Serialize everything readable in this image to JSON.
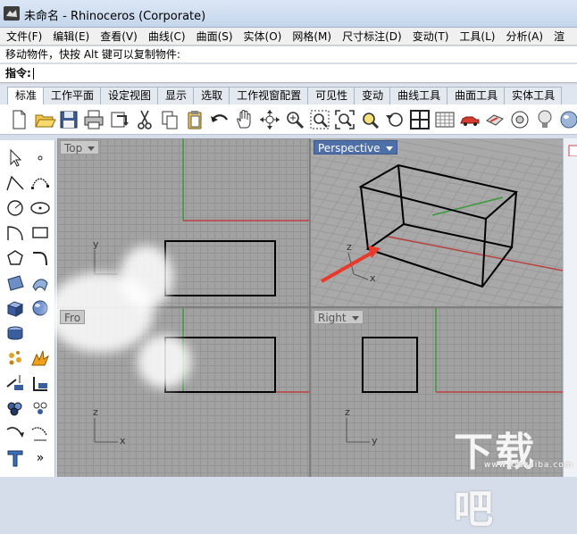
{
  "window": {
    "title": "未命名 - Rhinoceros (Corporate)"
  },
  "menu": [
    {
      "label": "文件(F)"
    },
    {
      "label": "编辑(E)"
    },
    {
      "label": "查看(V)"
    },
    {
      "label": "曲线(C)"
    },
    {
      "label": "曲面(S)"
    },
    {
      "label": "实体(O)"
    },
    {
      "label": "网格(M)"
    },
    {
      "label": "尺寸标注(D)"
    },
    {
      "label": "变动(T)"
    },
    {
      "label": "工具(L)"
    },
    {
      "label": "分析(A)"
    },
    {
      "label": "渲"
    }
  ],
  "status_line": "移动物件，快按 Alt 键可以复制物件:",
  "command": {
    "label": "指令:"
  },
  "tabs": [
    {
      "label": "标准",
      "active": true
    },
    {
      "label": "工作平面"
    },
    {
      "label": "设定视图"
    },
    {
      "label": "显示"
    },
    {
      "label": "选取"
    },
    {
      "label": "工作视窗配置"
    },
    {
      "label": "可见性"
    },
    {
      "label": "变动"
    },
    {
      "label": "曲线工具"
    },
    {
      "label": "曲面工具"
    },
    {
      "label": "实体工具"
    }
  ],
  "toolbar_icons": [
    "new-file-icon",
    "open-folder-icon",
    "save-icon",
    "print-icon",
    "import-icon",
    "cut-icon",
    "copy-icon",
    "paste-icon",
    "undo-icon",
    "pan-hand-icon",
    "rotate-view-icon",
    "zoom-icon",
    "zoom-window-icon",
    "zoom-extents-icon",
    "zoom-selected-icon",
    "undo-view-icon",
    "four-viewports-icon",
    "grid-icon",
    "car-render-icon",
    "render-preview-icon",
    "properties-icon",
    "material-icon",
    "sphere-icon",
    "light-bulb-icon"
  ],
  "sidebar_icons": [
    "select-arrow-icon",
    "point-icon",
    "polyline-icon",
    "curve-icon",
    "circle-icon",
    "ellipse-icon",
    "arc-icon",
    "rectangle-icon",
    "polygon-icon",
    "fillet-icon",
    "surface-icon",
    "surface-edge-icon",
    "box-solid-icon",
    "sphere-solid-icon",
    "cylinder-icon",
    "boolean-icon",
    "explode-icon",
    "burst-icon",
    "split-icon",
    "trim-icon",
    "group-icon",
    "points-cloud-icon",
    "curve-from-object-icon",
    "dimension-icon",
    "text-icon",
    "more-icon"
  ],
  "viewports": {
    "top": {
      "label": "Top",
      "axis_y": "y",
      "axis_x": "x"
    },
    "perspective": {
      "label": "Perspective",
      "axis_z": "z",
      "axis_x": "x"
    },
    "front": {
      "label": "Fro",
      "axis_z": "z",
      "axis_x": "x"
    },
    "right": {
      "label": "Right",
      "axis_z": "z",
      "axis_y": "y"
    }
  },
  "sidebar_more": "»",
  "watermark": {
    "text": "下载吧",
    "sub": "www.xiazaiba.com"
  },
  "colors": {
    "grid_bg": "#a2a2a2",
    "grid_line": "#949494",
    "axis_red": "#b94040",
    "axis_green": "#3a9a3a",
    "active_label": "#4f6fa8",
    "arrow_red": "#e83a2a"
  }
}
